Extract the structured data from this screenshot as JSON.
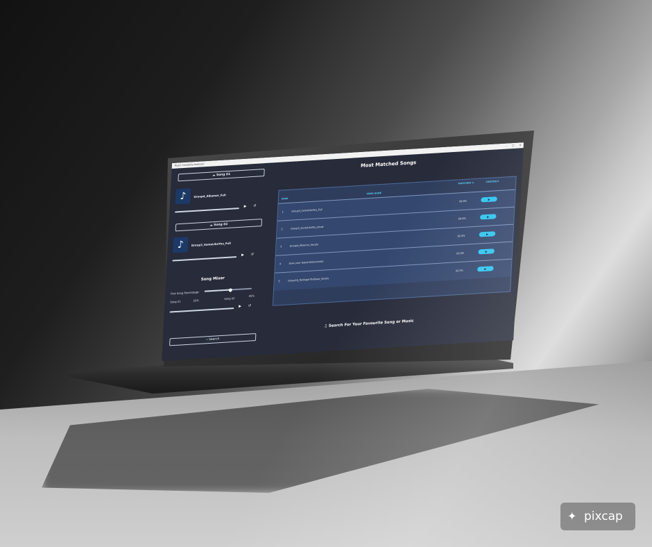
{
  "app": {
    "window_title": "Music Similarity Analyzer",
    "window_controls": "–  □  ✕"
  },
  "left_panel": {
    "song1_button": "Song 01",
    "song1_name": "Group4_Alkamor_Full",
    "song2_button": "Song 02",
    "song2_name": "Group3_SomeLikeYou_Full",
    "play_icon": "play-icon",
    "reset_icon": "reset-icon",
    "mixer_title": "Song Mixer",
    "first_song_percentage_label": "First Song Percentage:",
    "mixer_song1_label": "Song 01",
    "mixer_song1_pct": "55%",
    "mixer_song2_label": "Song 02",
    "mixer_song2_pct": "45%",
    "mixer_slider_value": 0.55,
    "search_button": "Search"
  },
  "right_panel": {
    "title": "Most Matched Songs",
    "columns": {
      "rank": "RANK",
      "song_name": "SONG NAME",
      "matching": "MATCHING %",
      "controls": "CONTROLS"
    },
    "rows": [
      {
        "rank": "1",
        "song": "Group3_SomeLikeYou_Full",
        "match": "69.8%"
      },
      {
        "rank": "2",
        "song": "Group3_SomeLikeYou_Vocal",
        "match": "69.8%"
      },
      {
        "rank": "3",
        "song": "Group4_Alkamor_Vocals",
        "match": "65.0%"
      },
      {
        "rank": "4",
        "song": "Save your tears(instruments)",
        "match": "65.0%"
      },
      {
        "rank": "5",
        "song": "Group16_RollinginTheDeep_Vocals",
        "match": "62.5%"
      }
    ],
    "play_symbol": "▶",
    "footer_text": "Search For Your Favourite Song or Music"
  },
  "watermark": {
    "text": "pixcap"
  },
  "colors": {
    "app_background": "#272b3a",
    "table_row": "#34476e",
    "accent_cyan": "#2ec4f0",
    "header_cyan": "#58c8f0"
  }
}
